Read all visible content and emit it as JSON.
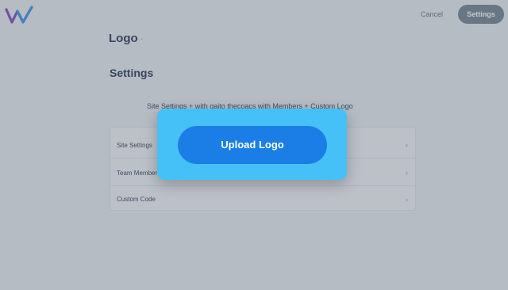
{
  "header": {
    "brand_icon": "wix-logo-icon",
    "brand_colors": [
      "#7b3fb8",
      "#2f8fe6"
    ],
    "cancel_label": "Cancel",
    "settings_label": "Settings"
  },
  "logo_section": {
    "title": "Logo",
    "marker": "·"
  },
  "settings_section": {
    "title": "Settings",
    "description": "Site Settings + with gaito thecoacs with Members + Custom Logo",
    "rows": [
      {
        "label": "Site Settings",
        "icon": "chevron-right-icon"
      },
      {
        "label": "Team Member",
        "icon": "chevron-right-icon"
      },
      {
        "label": "Custom Code",
        "icon": "chevron-right-icon"
      }
    ]
  },
  "modal": {
    "upload_label": "Upload Logo",
    "highlight_color": "#45c1f7",
    "button_color": "#1b7ee6"
  }
}
